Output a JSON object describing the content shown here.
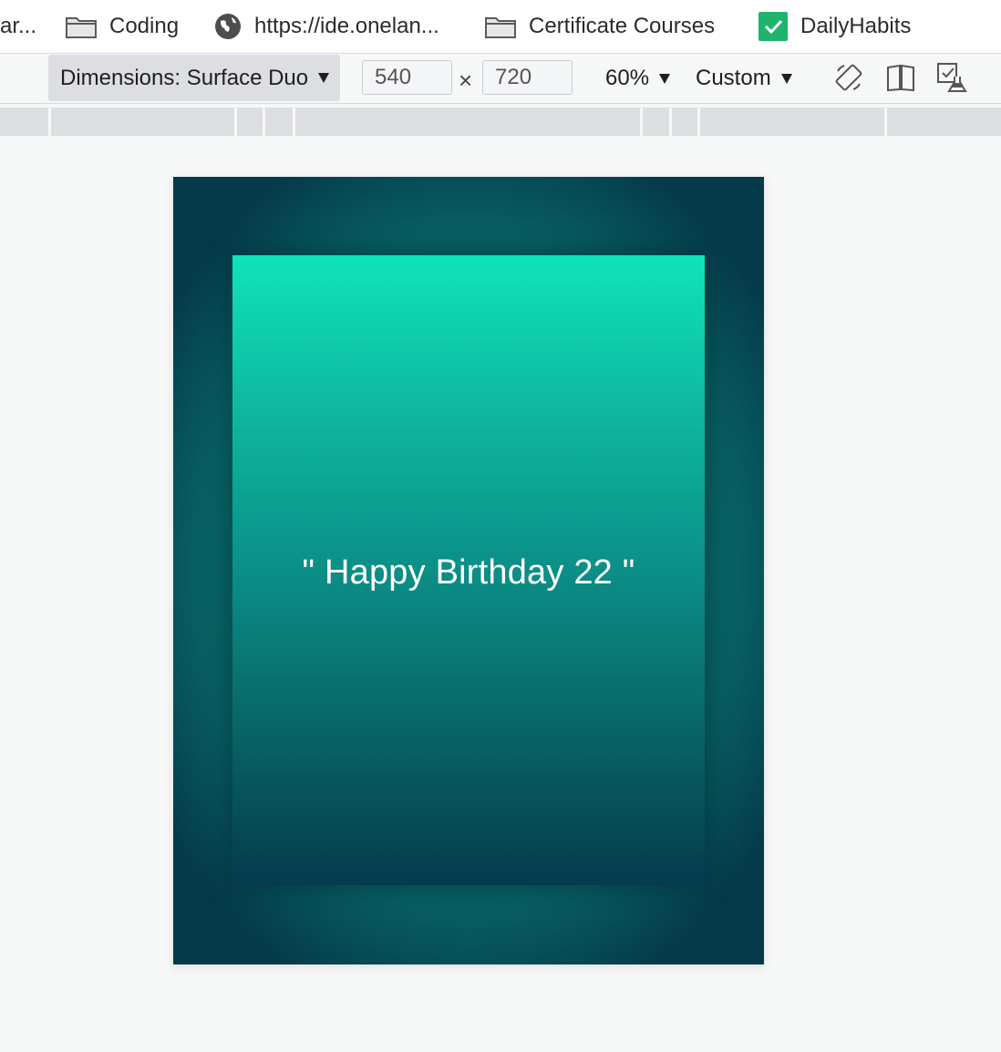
{
  "bookmarks": {
    "truncated": "ar...",
    "items": [
      {
        "label": "Coding",
        "icon": "folder-icon"
      },
      {
        "label": "https://ide.onelan...",
        "icon": "globe-icon"
      },
      {
        "label": "Certificate Courses",
        "icon": "folder-icon"
      },
      {
        "label": "DailyHabits",
        "icon": "green-check-icon"
      }
    ]
  },
  "device_toolbar": {
    "dimensions_label": "Dimensions: Surface Duo",
    "width": "540",
    "times": "×",
    "height": "720",
    "zoom": "60%",
    "throttling": "Custom"
  },
  "viewport": {
    "greeting": "\" Happy Birthday 22 \""
  },
  "colors": {
    "check_green": "#1fb46e",
    "card_top": "#10e3b9",
    "card_bottom": "#053b4d",
    "frame_center": "#0d9587",
    "frame_edge": "#053a4b"
  }
}
